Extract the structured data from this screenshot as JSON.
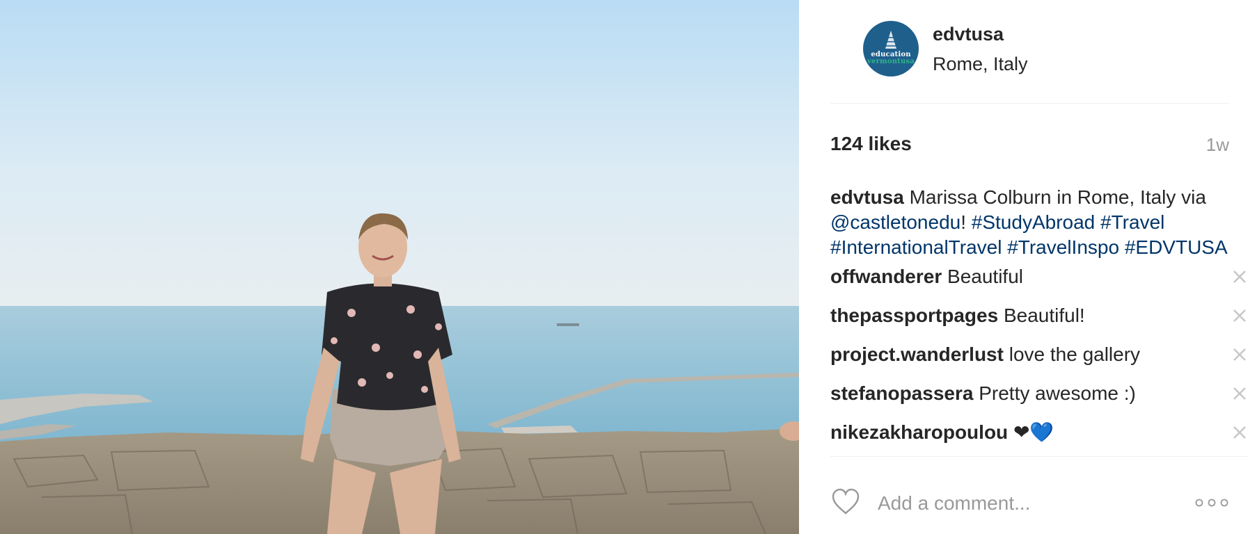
{
  "post": {
    "username": "edvtusa",
    "location": "Rome, Italy",
    "avatar_text_top": "education",
    "avatar_text_bottom": "vermontusa",
    "likes": "124 likes",
    "time": "1w"
  },
  "caption": {
    "user": "edvtusa",
    "text1": " Marissa Colburn in Rome, Italy via ",
    "mention": "@castletonedu",
    "text2": "! ",
    "tags": [
      "#StudyAbroad",
      "#Travel",
      "#InternationalTravel",
      "#TravelInspo",
      "#EDVTUSA"
    ]
  },
  "comments": [
    {
      "user": "offwanderer",
      "text": "Beautiful"
    },
    {
      "user": "thepassportpages",
      "text": "Beautiful!"
    },
    {
      "user": "project.wanderlust",
      "text": "love the gallery"
    },
    {
      "user": "stefanopassera",
      "text": "Pretty awesome :)"
    },
    {
      "user": "nikezakharopoulou",
      "text": "❤💙"
    }
  ],
  "footer": {
    "comment_placeholder": "Add a comment...",
    "heart_icon": "heart-outline-icon",
    "more_icon": "more-options-icon"
  },
  "colors": {
    "link": "#003569",
    "muted": "#999999",
    "avatar_bg": "#1f5f8c"
  }
}
